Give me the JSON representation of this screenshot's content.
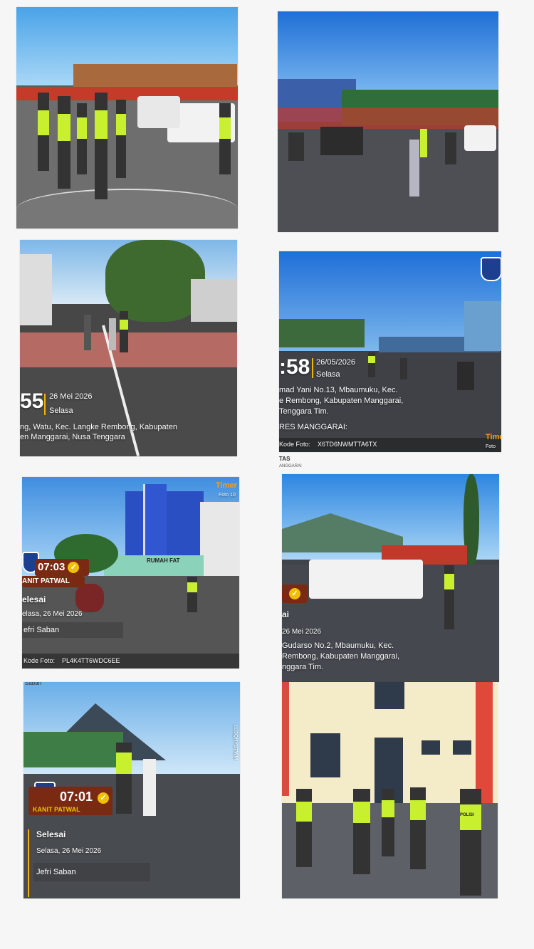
{
  "photos": {
    "p3": {
      "time": "55",
      "date": "26 Mei 2026",
      "day": "Selasa",
      "addr1": "ng, Watu, Kec. Langke Rembong, Kabupaten",
      "addr2": "en Manggarai, Nusa Tenggara"
    },
    "p4": {
      "time": ":58",
      "date": "26/05/2026",
      "day": "Selasa",
      "addr1": "mad Yani No.13, Mbaumuku, Kec.",
      "addr2": "e Rembong, Kabupaten Manggarai,",
      "addr3": "Tenggara Tim.",
      "org": "RES MANGGARAI:",
      "code_label": "Kode Foto:",
      "code": "X6TD6NWMTTA6TX",
      "timer": "Time",
      "foto": "Foto 10",
      "caption1": "TAS",
      "caption2": "ANGGARAI"
    },
    "p5": {
      "time": "07:03",
      "role": "ANIT PATWAL",
      "status": "elesai",
      "date": "elasa, 26 Mei 2026",
      "name": "efri Saban",
      "code_label": "Kode Foto:",
      "code": "PL4K4TT6WDC6EE",
      "timer": "Timer",
      "foto": "Foto 10",
      "sign": "RUMAH FAT"
    },
    "p6": {
      "status": "ai",
      "date": "26 Mei 2026",
      "addr1": "Gudarso No.2, Mbaumuku, Kec.",
      "addr2": "Rembong, Kabupaten Manggarai,",
      "addr3": "nggara Tim."
    },
    "p7": {
      "top": "Saban",
      "time": "07:01",
      "role": "KANIT PATWAL",
      "status": "Selesai",
      "date": "Selasa, 26 Mei 2026",
      "name": "Jefri Saban",
      "side": "LU3QHYSTWM"
    },
    "p8": {
      "vest_text": "POLISI"
    }
  }
}
